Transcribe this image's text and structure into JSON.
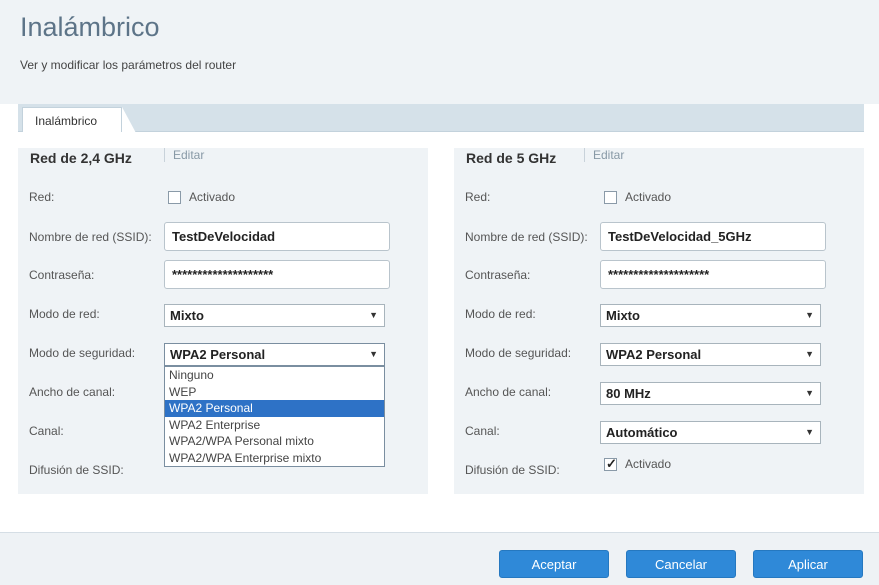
{
  "page": {
    "title": "Inalámbrico",
    "subtitle": "Ver y modificar los parámetros del router"
  },
  "tabs": [
    "Inalámbrico"
  ],
  "labels": {
    "network": "Red:",
    "ssid": "Nombre de red (SSID):",
    "password": "Contraseña:",
    "mode": "Modo de red:",
    "security": "Modo de seguridad:",
    "width": "Ancho de canal:",
    "channel": "Canal:",
    "broadcast": "Difusión de SSID:",
    "enabled": "Activado",
    "edit": "Editar"
  },
  "net24": {
    "title": "Red de 2,4 GHz",
    "ssid": "TestDeVelocidad",
    "password": "********************",
    "mode": "Mixto",
    "security": "WPA2 Personal",
    "security_options": [
      "Ninguno",
      "WEP",
      "WPA2 Personal",
      "WPA2 Enterprise",
      "WPA2/WPA Personal mixto",
      "WPA2/WPA Enterprise mixto"
    ]
  },
  "net5": {
    "title": "Red de 5 GHz",
    "ssid": "TestDeVelocidad_5GHz",
    "password": "********************",
    "mode": "Mixto",
    "security": "WPA2 Personal",
    "width": "80 MHz",
    "channel": "Automático"
  },
  "buttons": {
    "accept": "Aceptar",
    "cancel": "Cancelar",
    "apply": "Aplicar"
  },
  "colors": {
    "accent": "#2f89d8",
    "selected": "#2e72c6",
    "panel": "#eff3f6"
  }
}
